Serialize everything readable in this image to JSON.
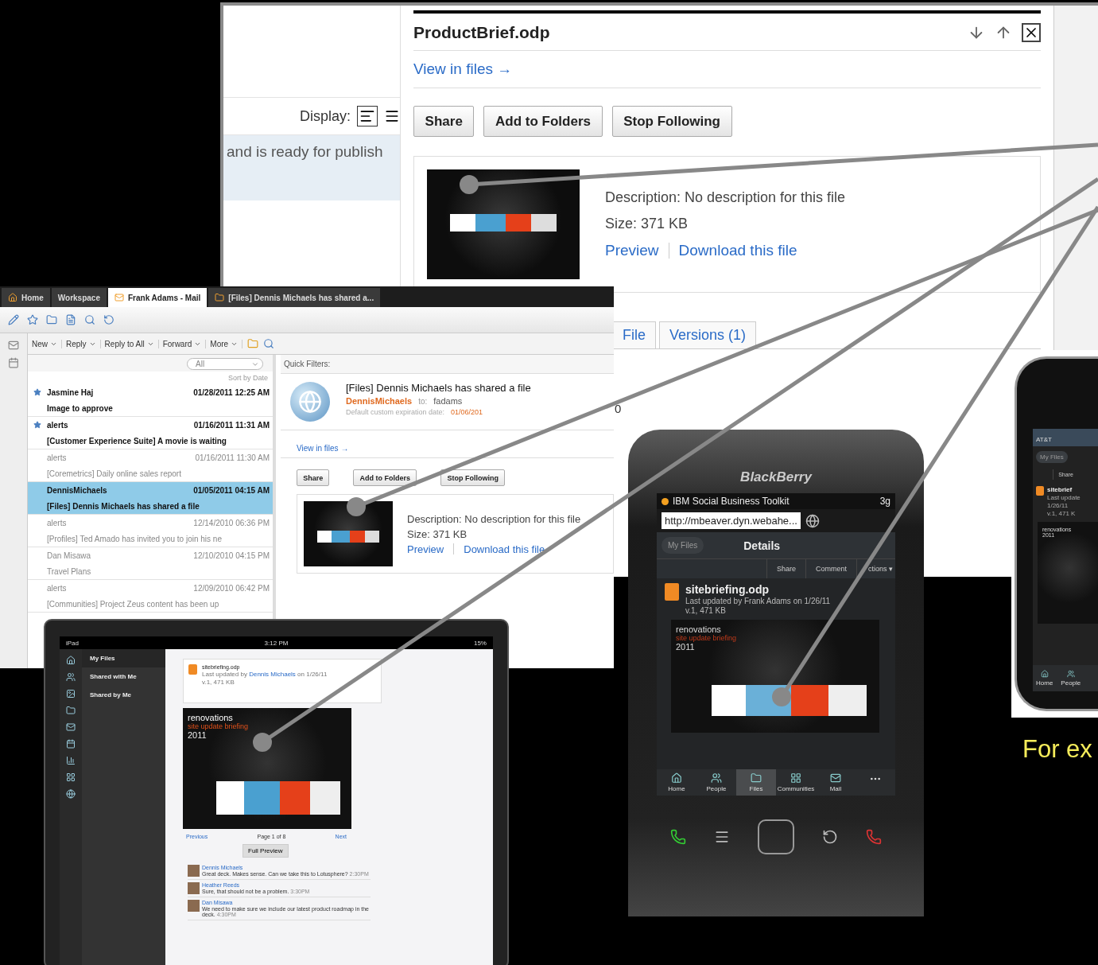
{
  "web_panel": {
    "display_label": "Display:",
    "snippet": "and is ready for publish",
    "file_title": "ProductBrief.odp",
    "view_in_files": "View in files →",
    "buttons": [
      "Share",
      "Add to Folders",
      "Stop Following"
    ],
    "description": "Description: No description for this file",
    "size": "Size: 371 KB",
    "links": [
      "Preview",
      "Download this file"
    ],
    "tabs": [
      {
        "label": "File",
        "selected": false
      },
      {
        "label": "Versions (1)",
        "selected": false
      }
    ],
    "count": "0"
  },
  "mail_client": {
    "tabs": [
      {
        "label": "Home",
        "selected": false
      },
      {
        "label": "Workspace",
        "selected": false
      },
      {
        "label": "Frank Adams - Mail",
        "selected": true
      },
      {
        "label": "[Files] Dennis Michaels has shared a...",
        "selected": false
      }
    ],
    "actions": [
      "New",
      "Reply",
      "Reply to All",
      "Forward",
      "More"
    ],
    "filter": "All",
    "sort": "Sort by Date",
    "messages": [
      {
        "sender": "Jasmine Haj",
        "date": "01/28/2011 12:25 AM",
        "subject": "Image to approve",
        "starred": true,
        "unread": true,
        "selected": false
      },
      {
        "sender": "alerts",
        "date": "01/16/2011 11:31 AM",
        "subject": "[Customer Experience Suite] A movie is waiting",
        "starred": true,
        "unread": true,
        "selected": false
      },
      {
        "sender": "alerts",
        "date": "01/16/2011 11:30 AM",
        "subject": "[Coremetrics] Daily online sales report",
        "starred": false,
        "unread": false,
        "selected": false
      },
      {
        "sender": "DennisMichaels",
        "date": "01/05/2011 04:15 AM",
        "subject": "[Files] Dennis Michaels has shared a file",
        "starred": false,
        "unread": true,
        "selected": true
      },
      {
        "sender": "alerts",
        "date": "12/14/2010 06:36 PM",
        "subject": "[Profiles] Ted Amado has invited you to join his ne",
        "starred": false,
        "unread": false,
        "selected": false
      },
      {
        "sender": "Dan Misawa",
        "date": "12/10/2010 04:15 PM",
        "subject": "Travel Plans",
        "starred": false,
        "unread": false,
        "selected": false
      },
      {
        "sender": "alerts",
        "date": "12/09/2010 06:42 PM",
        "subject": "[Communities] Project Zeus content has been up",
        "starred": false,
        "unread": false,
        "selected": false
      }
    ],
    "preview": {
      "quick_filters": "Quick Filters:",
      "title": "[Files] Dennis Michaels has shared a file",
      "from": "DennisMichaels",
      "to_label": "to:",
      "to": "fadams",
      "expiration": "Default custom expiration date:",
      "expiration_date": "01/06/201",
      "view_in_files": "View in files →",
      "buttons": [
        "Share",
        "Add to Folders",
        "Stop Following"
      ],
      "description": "Description: No description for this file",
      "size": "Size: 371 KB",
      "links": [
        "Preview",
        "Download this file"
      ]
    }
  },
  "ipad": {
    "carrier": "iPad",
    "time": "3:12 PM",
    "battery": "15%",
    "nav": [
      {
        "label": "My Files",
        "selected": true
      },
      {
        "label": "Shared with Me",
        "selected": false
      },
      {
        "label": "Shared by Me",
        "selected": false
      }
    ],
    "file": {
      "name": "sitebriefing.odp",
      "updated_prefix": "Last updated by",
      "author": "Dennis Michaels",
      "updated_suffix": "on 1/26/11",
      "meta": "v.1, 471 KB"
    },
    "slide": {
      "title": "renovations",
      "subtitle": "site update briefing",
      "year": "2011"
    },
    "pager": {
      "previous": "Previous",
      "page": "Page 1 of 8",
      "next": "Next"
    },
    "full_preview": "Full Preview",
    "comments": [
      {
        "author": "Dennis Michaels",
        "text": "Great deck. Makes sense. Can we take this to Lotusphere?",
        "time": "2:30PM"
      },
      {
        "author": "Heather Reeds",
        "text": "Sure, that should not be a problem.",
        "time": "3:30PM"
      },
      {
        "author": "Dan Misawa",
        "text": "We need to make sure we include our latest product roadmap in the deck.",
        "time": "4:30PM"
      }
    ]
  },
  "blackberry": {
    "brand": "BlackBerry",
    "app": "IBM Social Business Toolkit",
    "network": "3g",
    "url": "http://mbeaver.dyn.webahe...",
    "back": "My Files",
    "title": "Details",
    "actions": [
      "Share",
      "Comment",
      "ctions ▾"
    ],
    "file": {
      "name": "sitebriefing.odp",
      "updated": "Last updated by Frank Adams on 1/26/11",
      "meta": "v.1, 471 KB"
    },
    "slide": {
      "title": "renovations",
      "subtitle": "site update briefing",
      "year": "2011"
    },
    "nav": [
      {
        "label": "Home",
        "selected": false
      },
      {
        "label": "People",
        "selected": false
      },
      {
        "label": "Files",
        "selected": true
      },
      {
        "label": "Communities",
        "selected": false
      },
      {
        "label": "Mail",
        "selected": false
      }
    ]
  },
  "iphone": {
    "carrier": "AT&T",
    "back": "My Files",
    "actions": [
      "Share"
    ],
    "file": {
      "name": "sitebrief",
      "updated": "Last update",
      "date": "1/26/11",
      "meta": "v.1, 471 K"
    },
    "slide": {
      "title": "renovations",
      "year": "2011"
    },
    "nav": [
      "Home",
      "People"
    ]
  },
  "caption": [
    "For ex"
  ]
}
